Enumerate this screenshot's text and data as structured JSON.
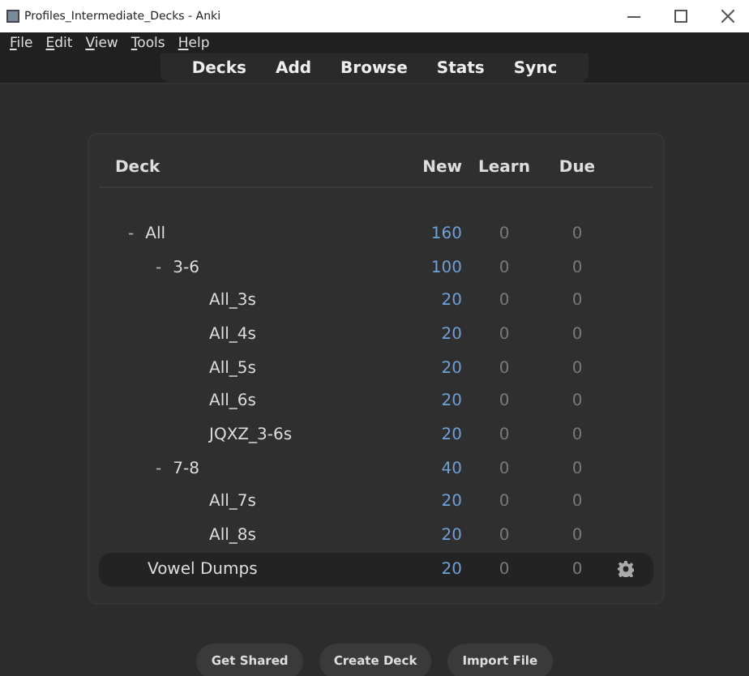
{
  "window": {
    "title": "Profiles_Intermediate_Decks - Anki"
  },
  "menu": [
    {
      "label": "File",
      "first_letter_underlined": true
    },
    {
      "label": "Edit",
      "first_letter_underlined": true
    },
    {
      "label": "View",
      "first_letter_underlined": true
    },
    {
      "label": "Tools",
      "first_letter_underlined": true
    },
    {
      "label": "Help",
      "first_letter_underlined": true
    }
  ],
  "toolbar": [
    "Decks",
    "Add",
    "Browse",
    "Stats",
    "Sync"
  ],
  "table": {
    "columns": [
      "Deck",
      "New",
      "Learn",
      "Due"
    ],
    "rows": [
      {
        "name": "All",
        "toggle": "-",
        "new": "160",
        "learn": "0",
        "due": "0",
        "selected": false,
        "children": [
          {
            "name": "3-6",
            "toggle": "-",
            "new": "100",
            "learn": "0",
            "due": "0",
            "selected": false,
            "children": [
              {
                "name": "All_3s",
                "new": "20",
                "learn": "0",
                "due": "0",
                "selected": false
              },
              {
                "name": "All_4s",
                "new": "20",
                "learn": "0",
                "due": "0",
                "selected": false
              },
              {
                "name": "All_5s",
                "new": "20",
                "learn": "0",
                "due": "0",
                "selected": false
              },
              {
                "name": "All_6s",
                "new": "20",
                "learn": "0",
                "due": "0",
                "selected": false
              },
              {
                "name": "JQXZ_3-6s",
                "new": "20",
                "learn": "0",
                "due": "0",
                "selected": false
              }
            ]
          },
          {
            "name": "7-8",
            "toggle": "-",
            "new": "40",
            "learn": "0",
            "due": "0",
            "selected": false,
            "children": [
              {
                "name": "All_7s",
                "new": "20",
                "learn": "0",
                "due": "0",
                "selected": false
              },
              {
                "name": "All_8s",
                "new": "20",
                "learn": "0",
                "due": "0",
                "selected": false
              }
            ]
          }
        ]
      },
      {
        "name": "Vowel Dumps",
        "new": "20",
        "learn": "0",
        "due": "0",
        "selected": true
      }
    ]
  },
  "buttons": [
    "Get Shared",
    "Create Deck",
    "Import File"
  ]
}
